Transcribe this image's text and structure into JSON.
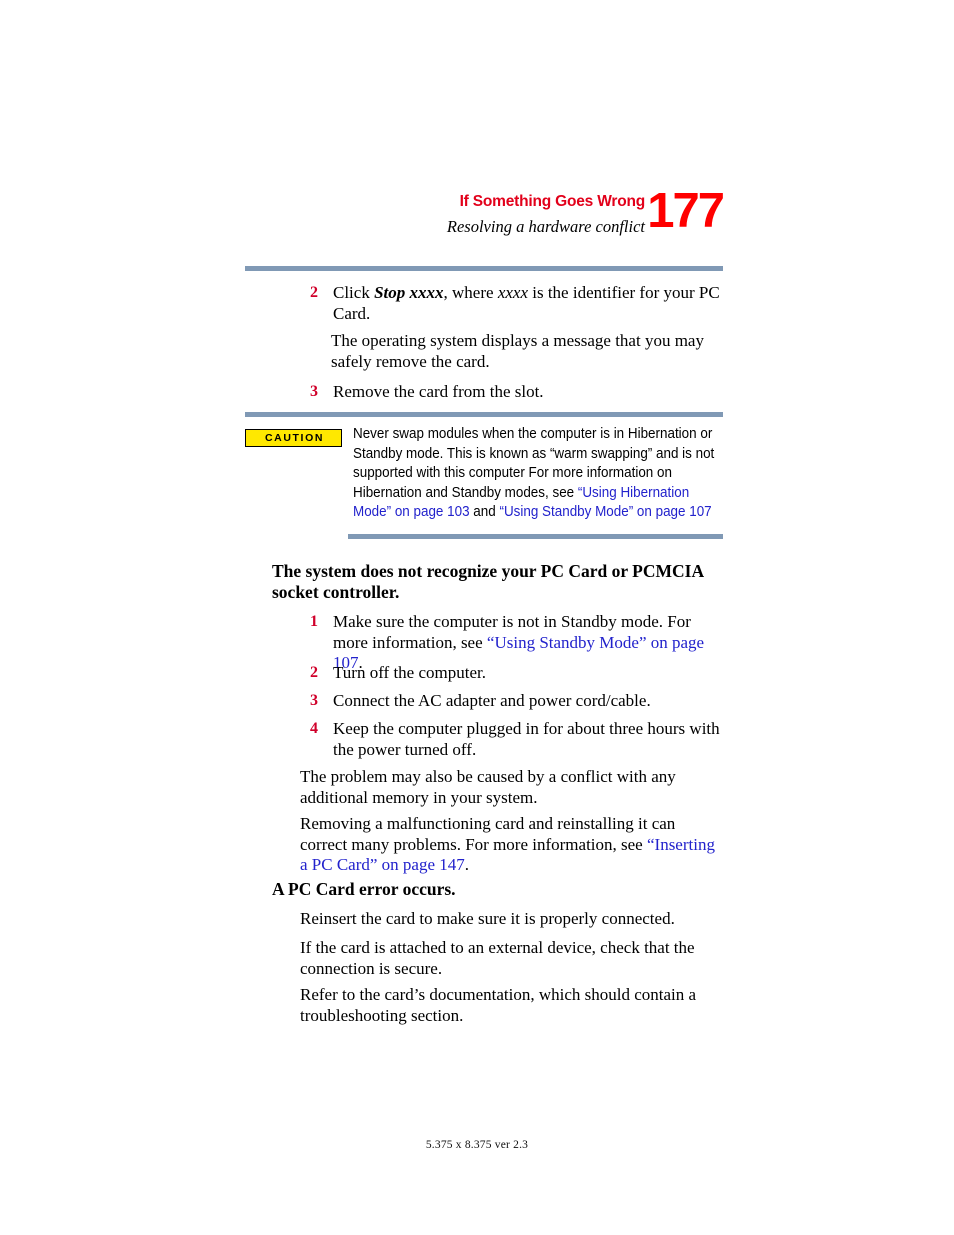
{
  "header": {
    "chapter_title": "If Something Goes Wrong",
    "section_title": "Resolving a hardware conflict",
    "page_number": "177"
  },
  "caution": {
    "label": "CAUTION",
    "text_part1": "Never swap modules when the computer is in Hibernation or Standby mode. This is known as “warm swapping” and is not supported with this computer For more information on Hibernation and Standby modes, see ",
    "link1": "“Using Hibernation Mode” on page 103",
    "text_mid": " and ",
    "link2": "“Using Standby Mode” on page 107"
  },
  "steps_top": [
    {
      "num": "2",
      "text_pre": "Click ",
      "bold_italic": "Stop xxxx",
      "text_mid": ", where ",
      "italic": "xxxx",
      "text_post": " is the identifier for your PC Card."
    },
    {
      "num": "3",
      "text_pre": "Remove the card from the slot.",
      "bold_italic": "",
      "text_mid": "",
      "italic": "",
      "text_post": ""
    }
  ],
  "paragraph_after_step2": "The operating system displays a message that you may safely remove the card.",
  "section1": {
    "heading": "The system does not recognize your PC Card or PCMCIA socket controller.",
    "steps": [
      {
        "num": "1",
        "text_pre": "Make sure the computer is not in Standby mode. For more information, see ",
        "link": "“Using Standby Mode” on page 107",
        "text_post": "."
      },
      {
        "num": "2",
        "text_pre": "Turn off the computer.",
        "link": "",
        "text_post": ""
      },
      {
        "num": "3",
        "text_pre": "Connect the AC adapter and power cord/cable.",
        "link": "",
        "text_post": ""
      },
      {
        "num": "4",
        "text_pre": "Keep the computer plugged in for about three hours with the power turned off.",
        "link": "",
        "text_post": ""
      }
    ],
    "paragraph1": "The problem may also be caused by a conflict with any additional memory in your system.",
    "paragraph2_pre": "Removing a malfunctioning card and reinstalling it can correct many problems. For more information, see ",
    "paragraph2_link": "“Inserting a PC Card” on page 147",
    "paragraph2_post": "."
  },
  "section2": {
    "heading": "A PC Card error occurs.",
    "paragraphs": [
      "Reinsert the card to make sure it is properly connected.",
      "If the card is attached to an external device, check that the connection is secure.",
      "Refer to the card’s documentation, which should contain a troubleshooting section."
    ]
  },
  "footer": {
    "text": "5.375 x 8.375 ver 2.3"
  },
  "colors": {
    "rule": "#8099b5",
    "accent_red": "#e2001a",
    "page_number_red": "#ff0000",
    "step_number_red": "#d0002a",
    "link_blue": "#2222cc",
    "caution_yellow": "#ffe800"
  }
}
